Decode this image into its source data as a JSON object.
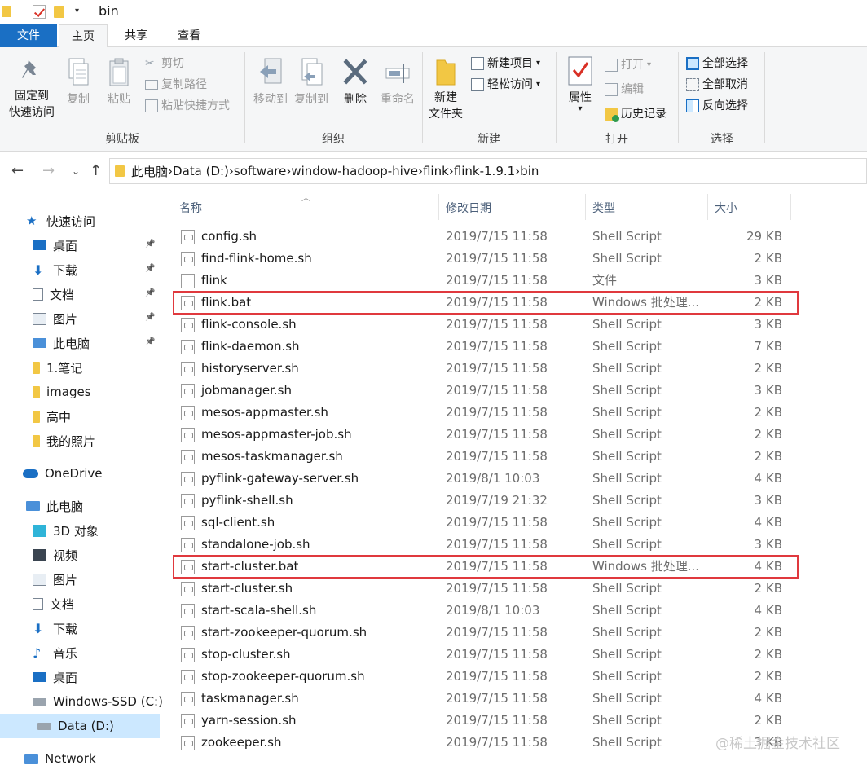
{
  "window": {
    "title": "bin"
  },
  "ribbon_tabs": {
    "file": "文件",
    "home": "主页",
    "share": "共享",
    "view": "查看"
  },
  "clipboard": {
    "pin_line1": "固定到",
    "pin_line2": "快速访问",
    "copy": "复制",
    "paste": "粘贴",
    "cut": "剪切",
    "copy_path": "复制路径",
    "paste_shortcut": "粘贴快捷方式",
    "label": "剪贴板"
  },
  "organize": {
    "move_to": "移动到",
    "copy_to": "复制到",
    "delete": "删除",
    "rename": "重命名",
    "label": "组织"
  },
  "new_group": {
    "new_item": "新建项目",
    "easy_access": "轻松访问",
    "new_folder_line1": "新建",
    "new_folder_line2": "文件夹",
    "label": "新建"
  },
  "open_group": {
    "properties": "属性",
    "open": "打开",
    "edit": "编辑",
    "history": "历史记录",
    "label": "打开"
  },
  "select_group": {
    "select_all": "全部选择",
    "select_none": "全部取消",
    "invert": "反向选择",
    "label": "选择"
  },
  "address": {
    "crumbs": [
      "此电脑",
      "Data (D:)",
      "software",
      "window-hadoop-hive",
      "flink",
      "flink-1.9.1",
      "bin"
    ]
  },
  "sidebar": {
    "items": [
      {
        "label": "快速访问",
        "icon": "star-icon"
      },
      {
        "label": "桌面",
        "icon": "desktop-icon",
        "pinned": true
      },
      {
        "label": "下载",
        "icon": "download-icon",
        "pinned": true
      },
      {
        "label": "文档",
        "icon": "document-icon",
        "pinned": true
      },
      {
        "label": "图片",
        "icon": "pictures-icon",
        "pinned": true
      },
      {
        "label": "此电脑",
        "icon": "computer-icon",
        "pinned": true
      },
      {
        "label": "1.笔记",
        "icon": "folder-icon"
      },
      {
        "label": "images",
        "icon": "folder-icon"
      },
      {
        "label": "高中",
        "icon": "folder-icon"
      },
      {
        "label": "我的照片",
        "icon": "folder-icon"
      },
      {
        "label": "OneDrive",
        "icon": "cloud-icon"
      },
      {
        "label": "此电脑",
        "icon": "computer-icon"
      },
      {
        "label": "3D 对象",
        "icon": "cube-icon"
      },
      {
        "label": "视频",
        "icon": "video-icon"
      },
      {
        "label": "图片",
        "icon": "pictures-icon"
      },
      {
        "label": "文档",
        "icon": "document-icon"
      },
      {
        "label": "下载",
        "icon": "download-icon"
      },
      {
        "label": "音乐",
        "icon": "music-icon"
      },
      {
        "label": "桌面",
        "icon": "desktop-icon"
      },
      {
        "label": "Windows-SSD (C:)",
        "icon": "drive-icon"
      },
      {
        "label": "Data (D:)",
        "icon": "drive-icon",
        "selected": true
      },
      {
        "label": "Network",
        "icon": "network-icon"
      }
    ]
  },
  "columns": {
    "name": "名称",
    "date": "修改日期",
    "type": "类型",
    "size": "大小"
  },
  "files": [
    {
      "name": "config.sh",
      "date": "2019/7/15 11:58",
      "type": "Shell Script",
      "size": "29 KB"
    },
    {
      "name": "find-flink-home.sh",
      "date": "2019/7/15 11:58",
      "type": "Shell Script",
      "size": "2 KB"
    },
    {
      "name": "flink",
      "date": "2019/7/15 11:58",
      "type": "文件",
      "size": "3 KB"
    },
    {
      "name": "flink.bat",
      "date": "2019/7/15 11:58",
      "type": "Windows 批处理...",
      "size": "2 KB",
      "highlighted": true
    },
    {
      "name": "flink-console.sh",
      "date": "2019/7/15 11:58",
      "type": "Shell Script",
      "size": "3 KB"
    },
    {
      "name": "flink-daemon.sh",
      "date": "2019/7/15 11:58",
      "type": "Shell Script",
      "size": "7 KB"
    },
    {
      "name": "historyserver.sh",
      "date": "2019/7/15 11:58",
      "type": "Shell Script",
      "size": "2 KB"
    },
    {
      "name": "jobmanager.sh",
      "date": "2019/7/15 11:58",
      "type": "Shell Script",
      "size": "3 KB"
    },
    {
      "name": "mesos-appmaster.sh",
      "date": "2019/7/15 11:58",
      "type": "Shell Script",
      "size": "2 KB"
    },
    {
      "name": "mesos-appmaster-job.sh",
      "date": "2019/7/15 11:58",
      "type": "Shell Script",
      "size": "2 KB"
    },
    {
      "name": "mesos-taskmanager.sh",
      "date": "2019/7/15 11:58",
      "type": "Shell Script",
      "size": "2 KB"
    },
    {
      "name": "pyflink-gateway-server.sh",
      "date": "2019/8/1 10:03",
      "type": "Shell Script",
      "size": "4 KB"
    },
    {
      "name": "pyflink-shell.sh",
      "date": "2019/7/19 21:32",
      "type": "Shell Script",
      "size": "3 KB"
    },
    {
      "name": "sql-client.sh",
      "date": "2019/7/15 11:58",
      "type": "Shell Script",
      "size": "4 KB"
    },
    {
      "name": "standalone-job.sh",
      "date": "2019/7/15 11:58",
      "type": "Shell Script",
      "size": "3 KB"
    },
    {
      "name": "start-cluster.bat",
      "date": "2019/7/15 11:58",
      "type": "Windows 批处理...",
      "size": "4 KB",
      "highlighted": true
    },
    {
      "name": "start-cluster.sh",
      "date": "2019/7/15 11:58",
      "type": "Shell Script",
      "size": "2 KB"
    },
    {
      "name": "start-scala-shell.sh",
      "date": "2019/8/1 10:03",
      "type": "Shell Script",
      "size": "4 KB"
    },
    {
      "name": "start-zookeeper-quorum.sh",
      "date": "2019/7/15 11:58",
      "type": "Shell Script",
      "size": "2 KB"
    },
    {
      "name": "stop-cluster.sh",
      "date": "2019/7/15 11:58",
      "type": "Shell Script",
      "size": "2 KB"
    },
    {
      "name": "stop-zookeeper-quorum.sh",
      "date": "2019/7/15 11:58",
      "type": "Shell Script",
      "size": "2 KB"
    },
    {
      "name": "taskmanager.sh",
      "date": "2019/7/15 11:58",
      "type": "Shell Script",
      "size": "4 KB"
    },
    {
      "name": "yarn-session.sh",
      "date": "2019/7/15 11:58",
      "type": "Shell Script",
      "size": "2 KB"
    },
    {
      "name": "zookeeper.sh",
      "date": "2019/7/15 11:58",
      "type": "Shell Script",
      "size": "3 KB"
    }
  ],
  "watermark": "@稀土掘金技术社区",
  "colors": {
    "accent": "#1a6fc4",
    "highlight_box": "#e0393e",
    "selected_bg": "#cce8ff",
    "folder": "#f2c744"
  }
}
